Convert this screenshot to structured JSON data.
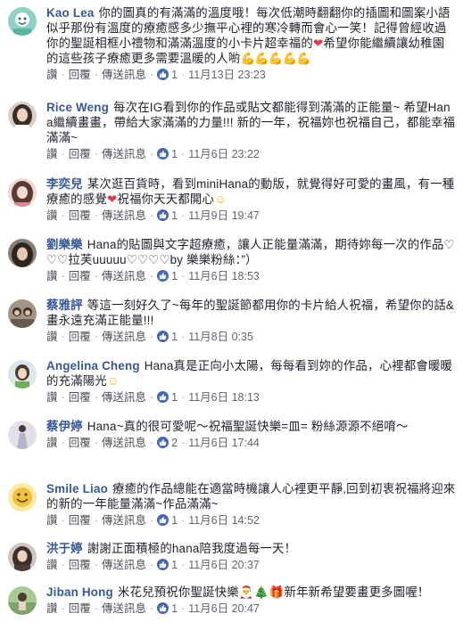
{
  "actions": {
    "like": "讚",
    "reply": "回覆",
    "message": "傳送訊息",
    "dot": "·"
  },
  "comments": [
    {
      "author": "Kao Lea",
      "text": "你的圖真的有滿滿的溫度哦！每次低潮時翻翻你的插圖和圖案小語 似乎那份有溫度的療癒感多少撫平心裡的寒冷轉而會心一笑！記得曾經收過你的聖誕相框小禮物和滿滿溫度的小卡片超幸福的",
      "text2": "希望你能繼續讓幼稚園的這些孩子療癒更多需要溫暖的人喲",
      "likes": "1",
      "time": "11月13日 23:23",
      "avatar_color": "#57b5a8",
      "avatar": "teal-illustration"
    },
    {
      "author": "Rice Weng",
      "text": "每次在IG看到你的作品或貼文都能得到滿滿的正能量~ 希望Hana繼續畫畫，帶給大家滿滿的力量!!! 新的一年，祝福妳也祝福自己，都能幸福滿滿~",
      "likes": "1",
      "time": "11月6日 23:22",
      "avatar_color": "#3a2e2a",
      "avatar": "woman-dark-hair"
    },
    {
      "author": "李奕兒",
      "text": "某次逛百貨時，看到miniHana的動版，就覺得好可愛的畫風，有一種療癒的感覺",
      "text2": "祝福你天天都開心",
      "likes": "1",
      "time": "11月9日 19:47",
      "avatar_color": "#d9a7a0",
      "avatar": "pink-woman"
    },
    {
      "author": "劉樂樂",
      "text": "Hana的貼圖與文字超療癒，讓人正能量滿滿，期待妳每一次的作品♡♡♡拉芙uuuuu♡♡♡♡by 樂樂粉絲：”）",
      "likes": "1",
      "time": "11月6日 18:53",
      "avatar_color": "#2b2622",
      "avatar": "dark-hair"
    },
    {
      "author": "蔡雅評",
      "text": "等這一刻好久了~每年的聖誕節都用你的卡片給人祝福，希望你的話&畫永遠充滿正能量!!!",
      "likes": "1",
      "time": "11月8日 0:35",
      "avatar_color": "#6b5a4e",
      "avatar": "group-photo"
    },
    {
      "author": "Angelina Cheng",
      "text": "Hana真是正向小太陽，每每看到妳的作品，心裡都會暖暖的充滿陽光",
      "likes": "1",
      "time": "11月6日 18:13",
      "avatar_color": "#c8d4da",
      "avatar": "child-green"
    },
    {
      "author": "蔡伊婷",
      "text": "Hana~真的很可愛呢～祝福聖誕快樂=皿= 粉絲源源不絕唷～",
      "likes": "2",
      "time": "11月6日 17:44",
      "avatar_color": "#b9b3c7",
      "avatar": "girl-dress"
    },
    {
      "author": "Smile Liao",
      "text": "療癒的作品總能在適當時機讓人心裡更平靜,回到初衷祝福將迎來的新的一年能量滿滿~作品滿滿~",
      "likes": "1",
      "time": "11月6日 14:52",
      "avatar_color": "#f0c23b",
      "avatar": "yellow-smile"
    },
    {
      "author": "洪于婷",
      "text": "謝謝正面積極的hana陪我度過每一天！",
      "likes": "1",
      "time": "11月6日 20:37",
      "avatar_color": "#4a3c38",
      "avatar": "woman-sweater"
    },
    {
      "author": "Jiban Hong",
      "text": "米花兒預祝你聖誕快樂",
      "text2": "新年新希望要畫更多圖喔！",
      "likes": "1",
      "time": "11月6日 20:47",
      "avatar_color": "#7ea36b",
      "avatar": "outdoor-person"
    }
  ]
}
